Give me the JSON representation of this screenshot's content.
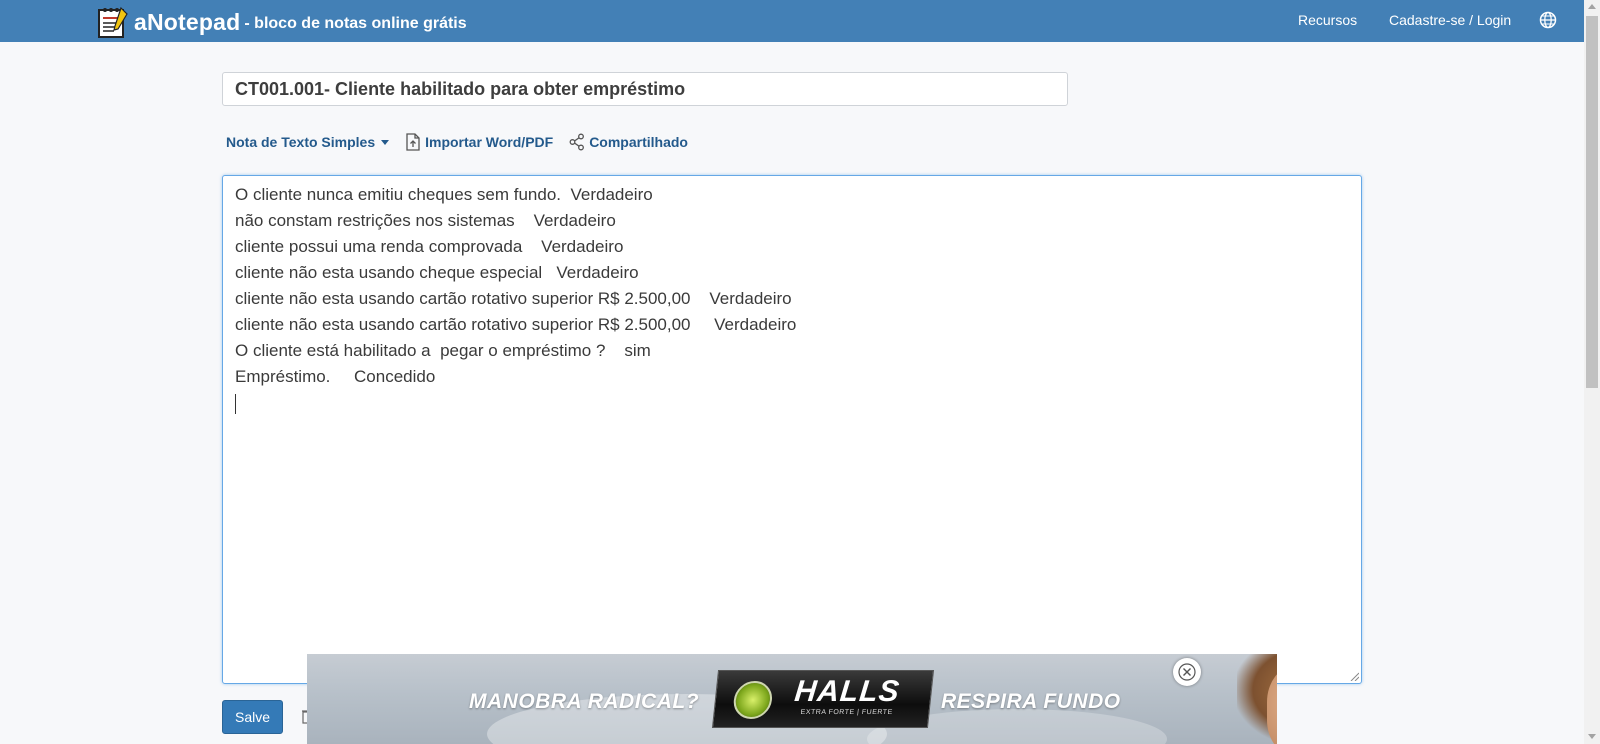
{
  "header": {
    "brand_name": "aNotepad",
    "brand_tagline": "- bloco de notas online grátis",
    "nav": {
      "recursos": "Recursos",
      "login": "Cadastre-se / Login"
    },
    "background_color": "#4380b6"
  },
  "note": {
    "title": "CT001.001- Cliente habilitado para obter empréstimo",
    "body_lines": [
      "O cliente nunca emitiu cheques sem fundo.  Verdadeiro",
      "não constam restrições nos sistemas    Verdadeiro",
      "cliente possui uma renda comprovada    Verdadeiro",
      "cliente não esta usando cheque especial   Verdadeiro",
      "cliente não esta usando cartão rotativo superior R$ 2.500,00    Verdadeiro",
      "cliente não esta usando cartão rotativo superior R$ 2.500,00     Verdadeiro",
      "O cliente está habilitado a  pegar o empréstimo ?    sim",
      "Empréstimo.     Concedido"
    ]
  },
  "toolbar": {
    "note_type": "Nota de Texto Simples",
    "import": "Importar Word/PDF",
    "share": "Compartilhado"
  },
  "actions": {
    "save_label": "Salve",
    "save_color": "#347ab7"
  },
  "ad": {
    "left_text": "MANOBRA RADICAL?",
    "brand": "HALLS",
    "brand_subtext": "EXTRA FORTE | FUERTE",
    "right_text": "RESPIRA FUNDO"
  },
  "icons": {
    "logo": "notepad-icon",
    "globe": "globe-icon",
    "import": "file-upload-icon",
    "share": "share-icon",
    "close": "close-icon"
  }
}
